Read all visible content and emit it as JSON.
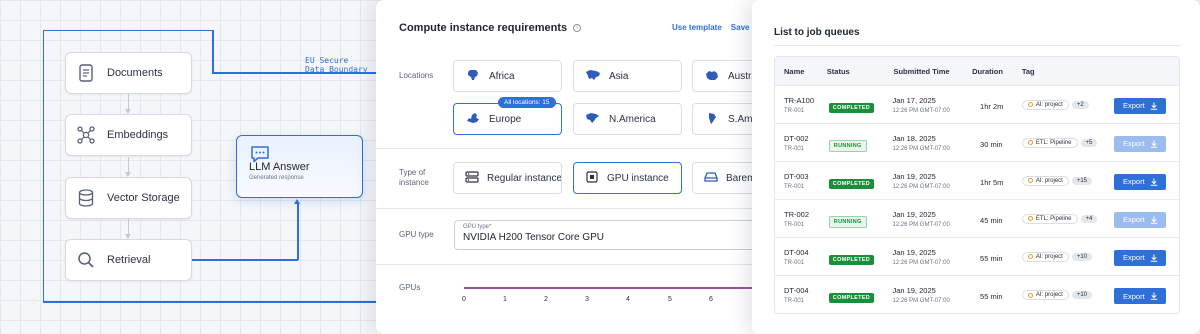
{
  "diagram": {
    "boundary_label": "EU Secure\nData Boundary",
    "nodes": [
      {
        "label": "Documents",
        "icon": "document-icon"
      },
      {
        "label": "Embeddings",
        "icon": "graph-nodes-icon"
      },
      {
        "label": "Vector Storage",
        "icon": "database-icon"
      },
      {
        "label": "Retrieval",
        "icon": "search-icon"
      }
    ],
    "llm": {
      "title": "LLM Answer",
      "subtitle": "Generated response",
      "icon": "chat-bubble-icon"
    },
    "accent": "#2e6fd8"
  },
  "compute": {
    "title": "Compute instance requirements",
    "use_template": "Use template",
    "save_as": "Save as t",
    "locations_label": "Locations",
    "locations": [
      {
        "label": "Africa",
        "selected": false
      },
      {
        "label": "Asia",
        "selected": false
      },
      {
        "label": "Australia",
        "selected": false
      },
      {
        "label": "Europe",
        "selected": true
      },
      {
        "label": "N.America",
        "selected": false
      },
      {
        "label": "S.America",
        "selected": false
      }
    ],
    "all_locations_badge": "All locations: 15",
    "instance_type_label": "Type of\ninstance",
    "instance_types": [
      {
        "label": "Regular instance",
        "icon": "server-icon",
        "selected": false
      },
      {
        "label": "GPU instance",
        "icon": "chip-icon",
        "selected": true
      },
      {
        "label": "Baremetal",
        "icon": "disk-icon",
        "selected": false
      }
    ],
    "gpu_type_label": "GPU type",
    "gpu_field_label": "GPU type*",
    "gpu_field_value": "NVIDIA H200 Tensor Core GPU",
    "gpus_label": "GPUs",
    "gpu_ticks": [
      "0",
      "1",
      "2",
      "3",
      "4",
      "5",
      "6"
    ]
  },
  "queues": {
    "title": "List to job queues",
    "columns": [
      "Name",
      "Status",
      "Submitted Time",
      "Duration",
      "Tag"
    ],
    "export_label": "Export",
    "rows": [
      {
        "name": "TR-A100",
        "sub": "TR-001",
        "status": "COMPLETED",
        "status_type": "completed",
        "date": "Jan 17, 2025",
        "time": "12:26 PM GMT-07:00",
        "duration": "1hr 2m",
        "tag": "AI: project",
        "count": "+2",
        "export_disabled": false
      },
      {
        "name": "DT-002",
        "sub": "TR-001",
        "status": "RUNNING",
        "status_type": "running",
        "date": "Jan 18, 2025",
        "time": "12:26 PM GMT-07:00",
        "duration": "30 min",
        "tag": "ETL: Pipeline",
        "count": "+5",
        "export_disabled": true
      },
      {
        "name": "DT-003",
        "sub": "TR-001",
        "status": "COMPLETED",
        "status_type": "completed",
        "date": "Jan 19, 2025",
        "time": "12:26 PM GMT-07:00",
        "duration": "1hr 5m",
        "tag": "AI: project",
        "count": "+15",
        "export_disabled": false
      },
      {
        "name": "TR-002",
        "sub": "TR-001",
        "status": "RUNNING",
        "status_type": "running",
        "date": "Jan 19, 2025",
        "time": "12:26 PM GMT-07:00",
        "duration": "45 min",
        "tag": "ETL: Pipeline",
        "count": "+4",
        "export_disabled": true
      },
      {
        "name": "DT-004",
        "sub": "TR-001",
        "status": "COMPLETED",
        "status_type": "completed",
        "date": "Jan 19, 2025",
        "time": "12:26 PM GMT-07:00",
        "duration": "55 min",
        "tag": "AI: project",
        "count": "+10",
        "export_disabled": false
      },
      {
        "name": "DT-004",
        "sub": "TR-001",
        "status": "COMPLETED",
        "status_type": "completed",
        "date": "Jan 19, 2025",
        "time": "12:26 PM GMT-07:00",
        "duration": "55 min",
        "tag": "AI: project",
        "count": "+10",
        "export_disabled": false
      }
    ]
  }
}
